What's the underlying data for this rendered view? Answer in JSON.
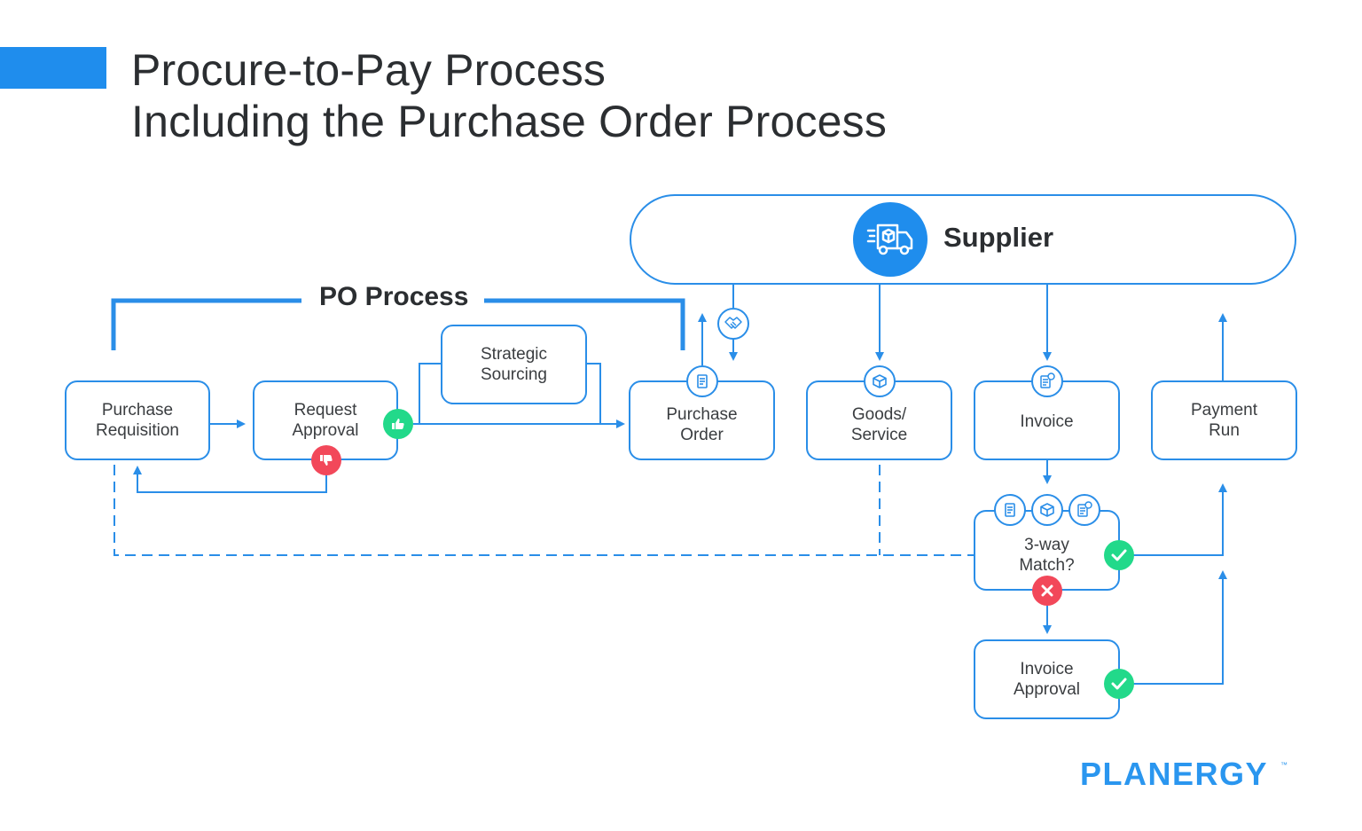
{
  "header": {
    "title_line1": "Procure-to-Pay Process",
    "title_line2": "Including the Purchase Order Process",
    "accent_color": "#1f8ded"
  },
  "supplier": {
    "label": "Supplier",
    "icon": "delivery-truck-icon"
  },
  "po_process": {
    "label": "PO Process"
  },
  "nodes": {
    "purchase_requisition": {
      "line1": "Purchase",
      "line2": "Requisition"
    },
    "request_approval": {
      "line1": "Request",
      "line2": "Approval"
    },
    "strategic_sourcing": {
      "line1": "Strategic",
      "line2": "Sourcing"
    },
    "purchase_order": {
      "line1": "Purchase",
      "line2": "Order",
      "icon": "purchase-order-document-icon"
    },
    "goods_service": {
      "line1": "Goods/",
      "line2": "Service",
      "icon": "package-box-icon"
    },
    "invoice": {
      "line1": "Invoice",
      "icon": "invoice-receipt-icon"
    },
    "payment_run": {
      "line1": "Payment",
      "line2": "Run"
    },
    "three_way_match": {
      "line1": "3-way",
      "line2": "Match?",
      "icons": [
        "purchase-order-document-icon",
        "package-box-icon",
        "invoice-receipt-icon"
      ]
    },
    "invoice_approval": {
      "line1": "Invoice",
      "line2": "Approval"
    }
  },
  "connectors": {
    "handshake_icon": "handshake-icon",
    "approve_icon": "thumbs-up-icon",
    "reject_icon": "thumbs-down-icon",
    "match_yes_icon": "check-icon",
    "match_no_icon": "x-icon",
    "invoice_approved_icon": "check-icon"
  },
  "colors": {
    "line": "#2a8ee8",
    "approve": "#22d98a",
    "reject": "#f2485a",
    "logo_accent": "#f26522"
  },
  "footer": {
    "logo": "PLANERGY",
    "trademark": "™"
  }
}
